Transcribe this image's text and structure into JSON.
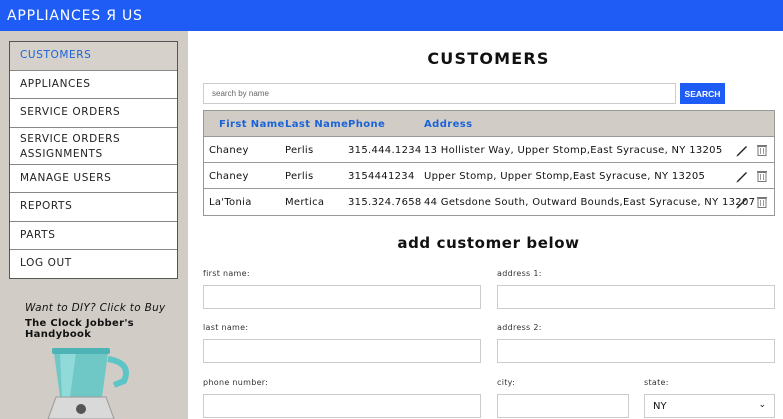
{
  "app": {
    "brand": "APPLIANCES Я US"
  },
  "sidebar": {
    "items": [
      {
        "label": "CUSTOMERS",
        "active": true
      },
      {
        "label": "APPLIANCES"
      },
      {
        "label": "SERVICE ORDERS"
      },
      {
        "label": "SERVICE ORDERS ASSIGNMENTS"
      },
      {
        "label": "MANAGE USERS"
      },
      {
        "label": "REPORTS"
      },
      {
        "label": "PARTS"
      },
      {
        "label": "LOG OUT"
      }
    ],
    "promo": {
      "line1": "Want to DIY? Click to Buy",
      "line2": "The Clock Jobber's Handybook"
    }
  },
  "main": {
    "title": "CUSTOMERS",
    "search": {
      "placeholder": "search by name",
      "button": "SEARCH"
    },
    "table": {
      "headers": [
        "First Name",
        "Last Name",
        "Phone",
        "Address"
      ],
      "rows": [
        {
          "first": "Chaney",
          "last": "Perlis",
          "phone": "315.444.1234",
          "address": "13 Hollister Way, Upper Stomp,East Syracuse, NY 13205"
        },
        {
          "first": "Chaney",
          "last": "Perlis",
          "phone": "3154441234",
          "address": "Upper Stomp, Upper Stomp,East Syracuse, NY 13205"
        },
        {
          "first": "La'Tonia",
          "last": "Mertica",
          "phone": "315.324.7658",
          "address": "44 Getsdone South, Outward Bounds,East Syracuse, NY 13207"
        }
      ],
      "actions": {
        "edit_icon": "pencil-icon",
        "delete_icon": "trash-icon"
      }
    },
    "form": {
      "title": "add customer below",
      "first_name_label": "first name:",
      "last_name_label": "last name:",
      "phone_label": "phone number:",
      "address1_label": "address 1:",
      "address2_label": "address 2:",
      "city_label": "city:",
      "state_label": "state:",
      "state_value": "NY"
    }
  },
  "colors": {
    "accent": "#1f5cf5",
    "link": "#1a63d8",
    "sidebar_bg": "#d1cdc6"
  }
}
